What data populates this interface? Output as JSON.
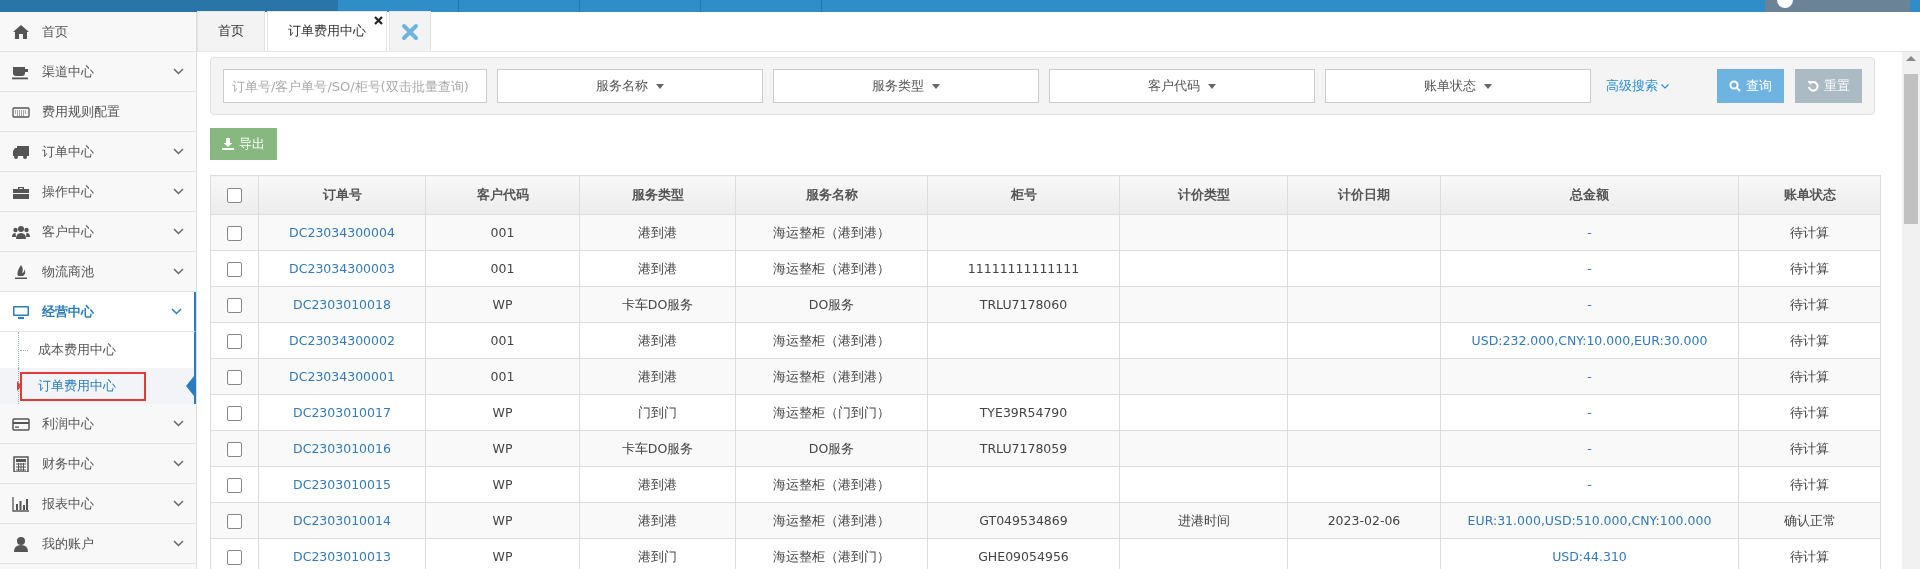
{
  "sidebar": {
    "items": [
      {
        "label": "首页",
        "kind": "link"
      },
      {
        "label": "渠道中心",
        "kind": "group",
        "expanded": false
      },
      {
        "label": "费用规则配置",
        "kind": "link"
      },
      {
        "label": "订单中心",
        "kind": "group",
        "expanded": false
      },
      {
        "label": "操作中心",
        "kind": "group",
        "expanded": false
      },
      {
        "label": "客户中心",
        "kind": "group",
        "expanded": false
      },
      {
        "label": "物流商池",
        "kind": "group",
        "expanded": false
      },
      {
        "label": "经营中心",
        "kind": "group",
        "expanded": true,
        "children": [
          {
            "label": "成本费用中心",
            "selected": false
          },
          {
            "label": "订单费用中心",
            "selected": true
          }
        ]
      },
      {
        "label": "利润中心",
        "kind": "group",
        "expanded": false
      },
      {
        "label": "财务中心",
        "kind": "group",
        "expanded": false
      },
      {
        "label": "报表中心",
        "kind": "group",
        "expanded": false
      },
      {
        "label": "我的账户",
        "kind": "group",
        "expanded": false
      }
    ]
  },
  "tabs": [
    {
      "label": "首页",
      "selected": false,
      "closable": false
    },
    {
      "label": "订单费用中心",
      "selected": true,
      "closable": true
    }
  ],
  "filters": {
    "search": {
      "placeholder": "订单号/客户单号/SO/柜号(双击批量查询)"
    },
    "dropdowns": [
      "服务名称",
      "服务类型",
      "客户代码",
      "账单状态"
    ],
    "advanced_search": "高级搜索",
    "buttons": [
      {
        "label": "查询",
        "kind": "search",
        "disabled": false
      },
      {
        "label": "重置",
        "kind": "reset",
        "disabled": true
      }
    ]
  },
  "export_button": "导出",
  "table": {
    "select_all_checked": false,
    "columns": [
      "订单号",
      "客户代码",
      "服务类型",
      "服务名称",
      "柜号",
      "计价类型",
      "计价日期",
      "总金额",
      "账单状态"
    ],
    "rows": [
      {
        "checked": false,
        "cells": [
          "DC23034300004",
          "001",
          "港到港",
          "海运整柜（港到港）",
          "",
          "",
          "",
          "-",
          "待计算"
        ]
      },
      {
        "checked": false,
        "cells": [
          "DC23034300003",
          "001",
          "港到港",
          "海运整柜（港到港）",
          "11111111111111",
          "",
          "",
          "-",
          "待计算"
        ]
      },
      {
        "checked": false,
        "cells": [
          "DC2303010018",
          "WP",
          "卡车DO服务",
          "DO服务",
          "TRLU7178060",
          "",
          "",
          "-",
          "待计算"
        ]
      },
      {
        "checked": false,
        "cells": [
          "DC23034300002",
          "001",
          "港到港",
          "海运整柜（港到港）",
          "",
          "",
          "",
          "USD:232.000,CNY:10.000,EUR:30.000",
          "待计算"
        ]
      },
      {
        "checked": false,
        "cells": [
          "DC23034300001",
          "001",
          "港到港",
          "海运整柜（港到港）",
          "",
          "",
          "",
          "-",
          "待计算"
        ]
      },
      {
        "checked": false,
        "cells": [
          "DC2303010017",
          "WP",
          "门到门",
          "海运整柜（门到门）",
          "TYE39R54790",
          "",
          "",
          "-",
          "待计算"
        ]
      },
      {
        "checked": false,
        "cells": [
          "DC2303010016",
          "WP",
          "卡车DO服务",
          "DO服务",
          "TRLU7178059",
          "",
          "",
          "-",
          "待计算"
        ]
      },
      {
        "checked": false,
        "cells": [
          "DC2303010015",
          "WP",
          "港到港",
          "海运整柜（港到港）",
          "",
          "",
          "",
          "-",
          "待计算"
        ]
      },
      {
        "checked": false,
        "cells": [
          "DC2303010014",
          "WP",
          "港到港",
          "海运整柜（港到港）",
          "GT049534869",
          "进港时间",
          "2023-02-06",
          "EUR:31.000,USD:510.000,CNY:100.000",
          "确认正常"
        ]
      },
      {
        "checked": false,
        "cells": [
          "DC2303010013",
          "WP",
          "港到门",
          "海运整柜（港到门）",
          "GHE09054956",
          "",
          "",
          "USD:44.310",
          "待计算"
        ]
      }
    ]
  }
}
